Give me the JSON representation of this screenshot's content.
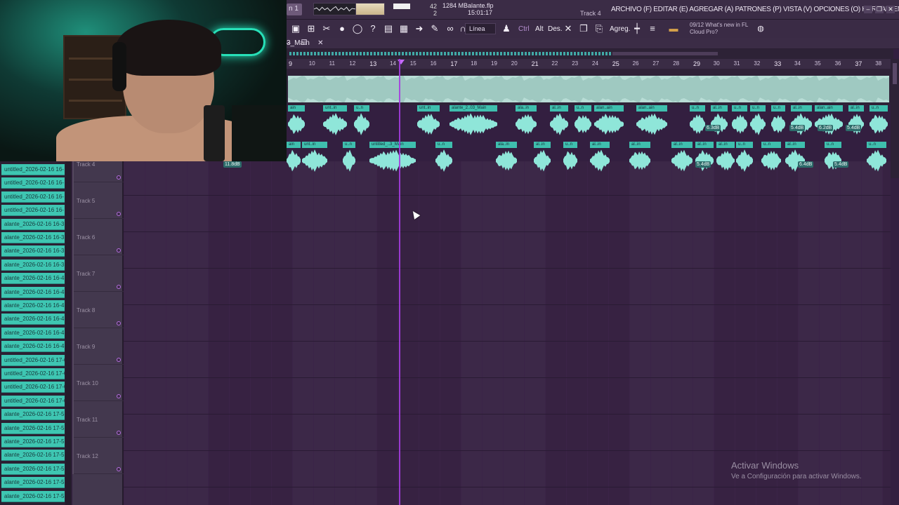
{
  "topbar": {
    "pattern_label": "n 1",
    "cpu_value": "42",
    "cpu_value2": "2",
    "memory": "1284 MB",
    "file_name": "alante.flp",
    "time": "15:01:17",
    "hint_track": "Track 4",
    "menu": "ARCHIVO (F) EDITAR (E) AGREGAR (A) PATRONES (P) VISTA (V) OPCIONES (O) HERRAMIENTAS (T) AYUDA",
    "window_buttons": [
      "‒",
      "❐",
      "✕"
    ]
  },
  "toolbar": {
    "snap": "Línea",
    "text_tools": [
      "Ctrl",
      "Alt",
      "Des.",
      "Agreg."
    ],
    "news_date": "09/12",
    "news_line1": "What's new in FL",
    "news_line2": "Cloud Pro?",
    "icons": [
      "save-icon",
      "pattern-icon",
      "cut-icon",
      "mic-icon",
      "chat-icon",
      "help-icon",
      "piano-roll-icon",
      "keyboard-icon",
      "arrow-icon",
      "pencil-icon",
      "link-icon",
      "magnet-icon",
      "stamp-icon",
      "delete-icon",
      "copy-icon",
      "paste-icon",
      "mixer-icon",
      "browser-icon",
      "globe-icon"
    ]
  },
  "playlist": {
    "title": "3_Main",
    "title_controls": "– ❐ ✕",
    "ruler_ticks": [
      "9",
      "10",
      "11",
      "12",
      "13",
      "14",
      "15",
      "16",
      "17",
      "18",
      "19",
      "20",
      "21",
      "22",
      "23",
      "24",
      "25",
      "26",
      "27",
      "28",
      "29",
      "30",
      "31",
      "32",
      "33",
      "34",
      "35",
      "36",
      "37",
      "38"
    ],
    "lane2_clips": [
      {
        "label": "ain"
      },
      {
        "label": "unt..in"
      },
      {
        "label": "u..n"
      },
      {
        "label": "unt..in"
      },
      {
        "label": "alante_2..03_Main"
      },
      {
        "label": "ala..in"
      },
      {
        "label": "al..in"
      },
      {
        "label": "u..n"
      },
      {
        "label": "alan..ain"
      },
      {
        "label": "alan..ain"
      },
      {
        "label": "u..n"
      },
      {
        "label": "al..in"
      },
      {
        "label": "u..n"
      },
      {
        "label": "u..n"
      },
      {
        "label": "u..n"
      },
      {
        "label": "al..in"
      },
      {
        "label": "alan..ain"
      },
      {
        "label": "al..in"
      },
      {
        "label": "u..n"
      }
    ],
    "lane2_gains": [
      "6.3dB",
      "5.4dB",
      "6.2dB",
      "5.4dB"
    ],
    "lane3_clips": [
      {
        "label": "ain"
      },
      {
        "label": "unt..in"
      },
      {
        "label": "u..n"
      },
      {
        "label": "untitled_..3_Main"
      },
      {
        "label": "u..n"
      },
      {
        "label": "ala..in"
      },
      {
        "label": "al..in"
      },
      {
        "label": "u..n"
      },
      {
        "label": "al..in"
      },
      {
        "label": "al..in"
      },
      {
        "label": "al..in"
      },
      {
        "label": "al..in"
      },
      {
        "label": "al..in"
      },
      {
        "label": "u..n"
      },
      {
        "label": "u..n"
      },
      {
        "label": "al..in"
      },
      {
        "label": "u..n"
      },
      {
        "label": "u..n"
      }
    ],
    "lane3_gains": [
      "11.8dB",
      "5.4dB",
      "6.4dB",
      "5.4dB"
    ],
    "tracks": [
      "Track 4",
      "Track 5",
      "Track 6",
      "Track 7",
      "Track 8",
      "Track 9",
      "Track 10",
      "Track 11",
      "Track 12"
    ]
  },
  "browser": {
    "items": [
      "untitled_2026-02-16 16-",
      "untitled_2026-02-16 16-",
      "untitled_2026-02-16 16-",
      "untitled_2026-02-16 16-",
      "alante_2026-02-16 16-3",
      "alante_2026-02-16 16-3",
      "alante_2026-02-16 16-3",
      "alante_2026-02-16 16-3",
      "alante_2026-02-16 16-4",
      "alante_2026-02-16 16-4",
      "alante_2026-02-16 16-4",
      "alante_2026-02-16 16-4",
      "alante_2026-02-16 16-4",
      "alante_2026-02-16 16-4",
      "untitled_2026-02-16 17-0",
      "untitled_2026-02-16 17-0",
      "untitled_2026-02-16 17-0",
      "untitled_2026-02-16 17-0",
      "alante_2026-02-16 17-5",
      "alante_2026-02-16 17-5",
      "alante_2026-02-16 17-5",
      "alante_2026-02-16 17-5",
      "alante_2026-02-16 17-5",
      "alante_2026-02-16 17-5",
      "alante_2026-02-16 17-5"
    ]
  },
  "watermark": {
    "line1": "Activar Windows",
    "line2": "Ve a Configuración para activar Windows."
  },
  "colors": {
    "accent": "#3fbfae",
    "playhead": "#a53ce0",
    "background": "#331f40"
  }
}
